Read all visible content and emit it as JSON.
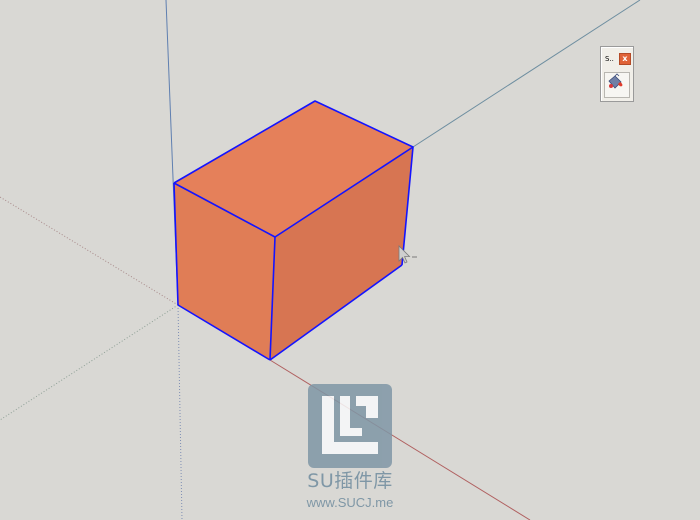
{
  "toolbar": {
    "title": "S..",
    "close_label": "x",
    "tool_icon": "paint-bucket-icon"
  },
  "watermark": {
    "brand": "SU插件库",
    "url": "www.SUCJ.me",
    "logo_icon": "sucj-logo-icon"
  },
  "colors": {
    "background": "#d9d8d4",
    "box_front": "#e07d56",
    "box_side": "#d77552",
    "box_top": "#e5805a",
    "selection_edge": "#1414ff",
    "axis_green": "#5a9b5a",
    "axis_red": "#b06060",
    "axis_blue": "#5f7fb0",
    "watermark": "#7f97a6"
  }
}
